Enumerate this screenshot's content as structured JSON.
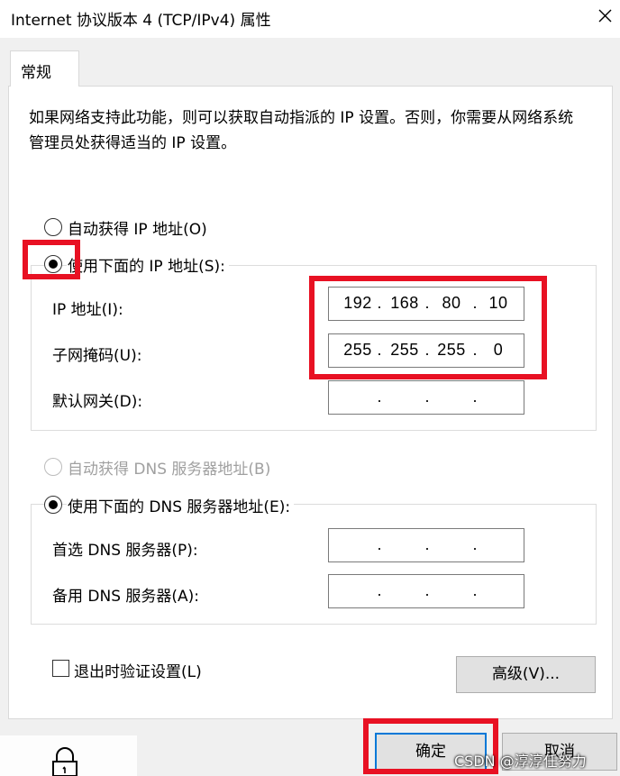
{
  "window": {
    "title": "Internet 协议版本 4 (TCP/IPv4) 属性"
  },
  "tabs": [
    {
      "label": "常规",
      "selected": true
    }
  ],
  "description": "如果网络支持此功能，则可以获取自动指派的 IP 设置。否则，你需要从网络系统管理员处获得适当的 IP 设置。",
  "ip_settings": {
    "auto_option": {
      "label": "自动获得 IP 地址(O)",
      "selected": false
    },
    "manual_option": {
      "label": "使用下面的 IP 地址(S):",
      "selected": true
    },
    "fields": [
      {
        "label": "IP 地址(I):",
        "octets": [
          "192",
          "168",
          "80",
          "10"
        ]
      },
      {
        "label": "子网掩码(U):",
        "octets": [
          "255",
          "255",
          "255",
          "0"
        ]
      },
      {
        "label": "默认网关(D):",
        "octets": [
          "",
          "",
          "",
          ""
        ]
      }
    ]
  },
  "dns_settings": {
    "auto_option": {
      "label": "自动获得 DNS 服务器地址(B)",
      "selected": false,
      "enabled": false
    },
    "manual_option": {
      "label": "使用下面的 DNS 服务器地址(E):",
      "selected": true
    },
    "fields": [
      {
        "label": "首选 DNS 服务器(P):",
        "octets": [
          "",
          "",
          "",
          ""
        ]
      },
      {
        "label": "备用 DNS 服务器(A):",
        "octets": [
          "",
          "",
          "",
          ""
        ]
      }
    ]
  },
  "validate_on_exit": {
    "label": "退出时验证设置(L)",
    "checked": false
  },
  "buttons": {
    "advanced": "高级(V)...",
    "ok": "确定",
    "cancel": "取消"
  },
  "watermark": "CSDN @淳淳任努力",
  "icons": {
    "close": "close-icon",
    "lock": "lock-icon"
  },
  "colors": {
    "highlight": "#e81123",
    "focus_border": "#0078d7",
    "dialog_bg": "#f0f0f0"
  }
}
